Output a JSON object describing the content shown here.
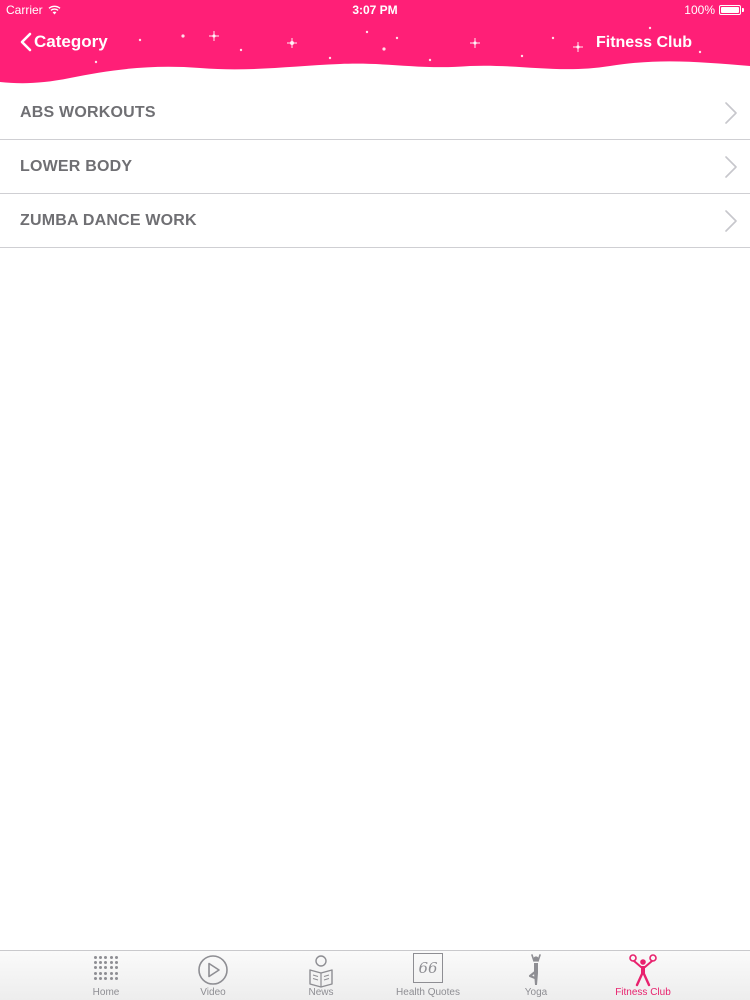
{
  "status_bar": {
    "carrier": "Carrier",
    "time": "3:07 PM",
    "battery_text": "100%",
    "battery_level": 1.0
  },
  "nav": {
    "back_label": "Category",
    "title": "Fitness Club"
  },
  "list": {
    "items": [
      {
        "label": "ABS WORKOUTS"
      },
      {
        "label": "LOWER BODY"
      },
      {
        "label": "ZUMBA DANCE WORK"
      }
    ]
  },
  "tabbar": {
    "tabs": [
      {
        "label": "Home",
        "icon": "home-dots-icon"
      },
      {
        "label": "Video",
        "icon": "play-circle-icon"
      },
      {
        "label": "News",
        "icon": "news-reader-icon"
      },
      {
        "label": "Health Quotes",
        "icon": "quote-icon",
        "glyph": "66"
      },
      {
        "label": "Yoga",
        "icon": "yoga-pose-icon"
      },
      {
        "label": "Fitness Club",
        "icon": "fitness-person-icon",
        "active": true
      }
    ]
  },
  "colors": {
    "header_pink": "#ff1f77",
    "active_tab": "#e8226e",
    "inactive_tab": "#8e8e93",
    "list_text": "#6f6f73"
  }
}
